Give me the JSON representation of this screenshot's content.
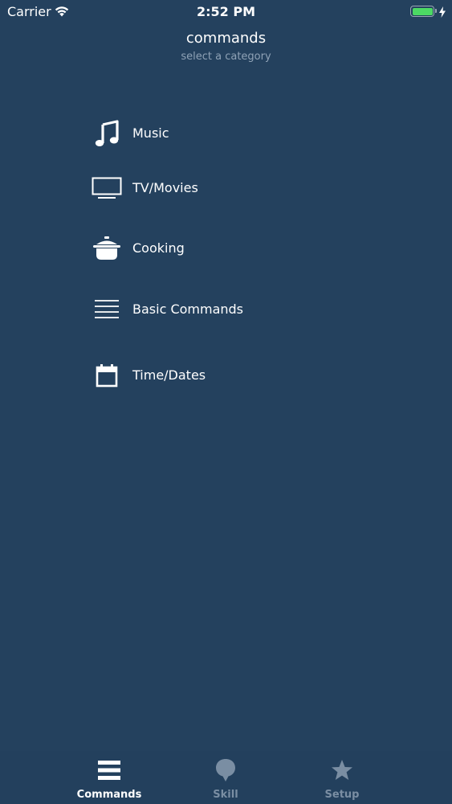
{
  "status_bar": {
    "carrier": "Carrier",
    "time": "2:52 PM",
    "battery_level": 1.0,
    "battery_color": "#4cd964"
  },
  "header": {
    "title": "commands",
    "subtitle": "select a category"
  },
  "categories": [
    {
      "label": "Music",
      "icon": "music-note-icon"
    },
    {
      "label": "TV/Movies",
      "icon": "tv-icon"
    },
    {
      "label": "Cooking",
      "icon": "cooking-pot-icon"
    },
    {
      "label": "Basic Commands",
      "icon": "list-lines-icon"
    },
    {
      "label": "Time/Dates",
      "icon": "calendar-icon"
    }
  ],
  "tab_bar": {
    "tabs": [
      {
        "label": "Commands",
        "icon": "menu-lines-icon",
        "active": true
      },
      {
        "label": "Skill",
        "icon": "speech-bubble-icon",
        "active": false
      },
      {
        "label": "Setup",
        "icon": "star-icon",
        "active": false
      }
    ]
  },
  "colors": {
    "background": "#24415e",
    "subtitle": "#8fa2b6",
    "tab_inactive": "#7a8ea3"
  }
}
